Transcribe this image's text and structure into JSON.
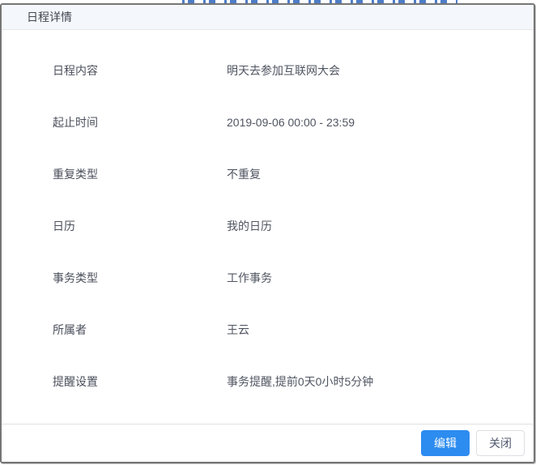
{
  "modal": {
    "title": "日程详情",
    "fields": [
      {
        "label": "日程内容",
        "value": "明天去参加互联网大会"
      },
      {
        "label": "起止时间",
        "value": "2019-09-06 00:00 - 23:59"
      },
      {
        "label": "重复类型",
        "value": "不重复"
      },
      {
        "label": "日历",
        "value": "我的日历"
      },
      {
        "label": "事务类型",
        "value": "工作事务"
      },
      {
        "label": "所属者",
        "value": "王云"
      },
      {
        "label": "提醒设置",
        "value": "事务提醒,提前0天0小时5分钟"
      }
    ],
    "footer": {
      "edit_label": "编辑",
      "close_label": "关闭"
    },
    "colors": {
      "primary_button": "#2d8cf0",
      "header_background": "#f4f8fd",
      "modal_border": "#757575"
    }
  }
}
